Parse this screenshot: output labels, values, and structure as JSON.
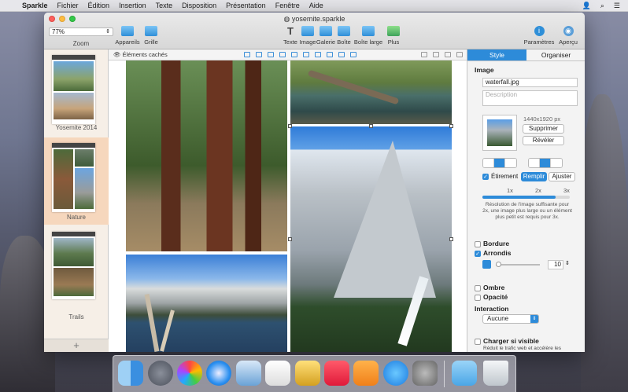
{
  "menubar": {
    "app": "Sparkle",
    "items": [
      "Fichier",
      "Édition",
      "Insertion",
      "Texte",
      "Disposition",
      "Présentation",
      "Fenêtre",
      "Aide"
    ]
  },
  "window": {
    "title": "yosemite.sparkle",
    "zoom_value": "77%",
    "zoom_label": "Zoom",
    "toolbar": {
      "appareils": "Appareils",
      "grille": "Grille",
      "texte": "Texte",
      "image": "Image",
      "galerie": "Galerie",
      "boite": "Boîte",
      "boite_large": "Boîte large",
      "plus": "Plus",
      "parametres": "Paramètres",
      "apercu": "Aperçu"
    }
  },
  "sidebar": {
    "pages": [
      {
        "label": "Yosemite 2014"
      },
      {
        "label": "Nature"
      },
      {
        "label": "Trails"
      }
    ],
    "add": "+"
  },
  "canvas": {
    "hidden_elements": "Éléments cachés"
  },
  "inspector": {
    "tab_style": "Style",
    "tab_organiser": "Organiser",
    "section_image": "Image",
    "filename": "waterfall.jpg",
    "description_placeholder": "Description",
    "dimensions": "1440x1920 px",
    "supprimer": "Supprimer",
    "reveler": "Révéler",
    "etirement": "Étirement",
    "remplir": "Remplir",
    "ajuster": "Ajuster",
    "res_1x": "1x",
    "res_2x": "2x",
    "res_3x": "3x",
    "resolution_note": "Résolution de l'image suffisante pour 2x, une image plus large ou un élément plus petit est requis pour 3x.",
    "bordure": "Bordure",
    "arrondis": "Arrondis",
    "arrondis_value": "10",
    "ombre": "Ombre",
    "opacite": "Opacité",
    "section_interaction": "Interaction",
    "interaction_value": "Aucune",
    "charger_si_visible": "Charger si visible",
    "charger_note": "Réduit le trafic web et accélère les performances du chargement des pages en reportant le téléchargement"
  },
  "colors": {
    "accent": "#2d8bd9",
    "selected_page": "#f6d7bd"
  }
}
